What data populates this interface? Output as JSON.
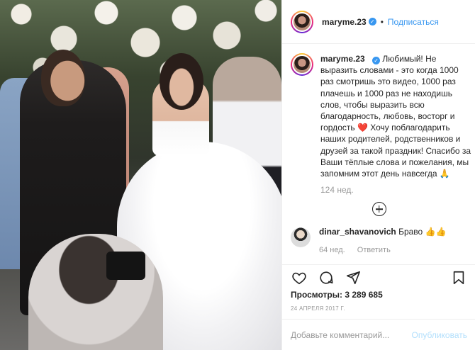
{
  "post": {
    "username": "maryme.23",
    "follow_label": "Подписаться",
    "separator": "•",
    "caption": "Любимый! Не выразить словами - это когда 1000 раз смотришь это видео, 1000 раз плачешь и 1000 раз не находишь слов, чтобы выразить всю благодарность, любовь, восторг и гордость ❤️ Хочу поблагодарить наших родителей, родственников и друзей за такой праздник! Спасибо за Ваши тёплые слова и пожелания, мы запомним этот день навсегда 🙏",
    "caption_time": "124 нед.",
    "views_label": "Просмотры:",
    "views_count": "3 289 685",
    "date": "24 АПРЕЛЯ 2017 Г."
  },
  "comments": [
    {
      "username": "dinar_shavanovich",
      "text": "Браво 👍👍",
      "time": "64 нед.",
      "reply_label": "Ответить"
    }
  ],
  "composer": {
    "placeholder": "Добавьте комментарий...",
    "publish_label": "Опубликовать"
  },
  "icons": {
    "verified": "verified-badge-icon",
    "load_more": "plus-circle-icon",
    "like": "heart-icon",
    "comment": "comment-icon",
    "share": "share-icon",
    "save": "bookmark-icon"
  },
  "colors": {
    "link": "#3897f0",
    "muted": "#999999",
    "publish_disabled": "#b2dffc",
    "text": "#262626"
  }
}
